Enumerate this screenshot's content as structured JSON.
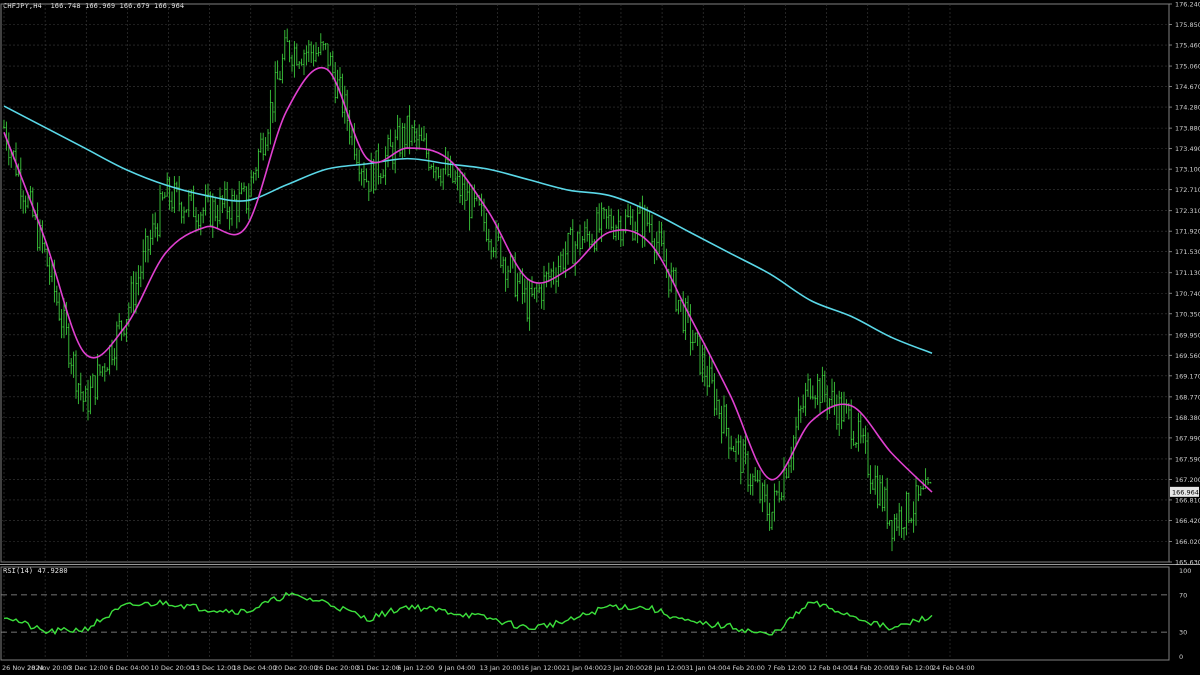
{
  "header": {
    "symbol": "CHFJPY,H4",
    "ohlc": "166.748 166.969 166.679 166.964"
  },
  "rsi_panel": {
    "label": "RSI(14) 47.9280",
    "levels": [
      "100",
      "70",
      "30",
      "0"
    ]
  },
  "price_axis": {
    "ticks": [
      "176.240",
      "175.850",
      "175.460",
      "175.060",
      "174.670",
      "174.280",
      "173.880",
      "173.490",
      "173.100",
      "172.710",
      "172.310",
      "171.920",
      "171.530",
      "171.130",
      "170.740",
      "170.350",
      "169.950",
      "169.560",
      "169.170",
      "168.770",
      "168.380",
      "167.990",
      "167.590",
      "167.200",
      "166.810",
      "166.420",
      "166.020",
      "165.630"
    ],
    "current_price": "166.964"
  },
  "time_axis": {
    "ticks": [
      "26 Nov 2024",
      "28 Nov 20:00",
      "3 Dec 12:00",
      "6 Dec 04:00",
      "10 Dec 20:00",
      "13 Dec 12:00",
      "18 Dec 04:00",
      "20 Dec 20:00",
      "26 Dec 20:00",
      "31 Dec 12:00",
      "6 Jan 12:00",
      "9 Jan 04:00",
      "13 Jan 20:00",
      "16 Jan 12:00",
      "21 Jan 04:00",
      "23 Jan 20:00",
      "28 Jan 12:00",
      "31 Jan 04:00",
      "4 Feb 20:00",
      "7 Feb 12:00",
      "12 Feb 04:00",
      "14 Feb 20:00",
      "19 Feb 12:00",
      "24 Feb 04:00"
    ]
  },
  "colors": {
    "background": "#000000",
    "grid": "#3c3c3c",
    "bars": "#3cc83c",
    "ma_fast": "#e040d0",
    "ma_slow": "#5ad8e8",
    "rsi_line": "#3ce03c",
    "price_tag_bg": "#e6e6e6"
  },
  "chart_data": [
    {
      "type": "line",
      "title": "CHFJPY,H4",
      "subtitle": "166.748 166.969 166.679 166.964",
      "ylim": [
        165.63,
        176.24
      ],
      "series": [
        {
          "style": "bars",
          "x": [
            "26 Nov 2024",
            "28 Nov 20:00",
            "3 Dec 12:00",
            "6 Dec 04:00",
            "10 Dec 20:00",
            "13 Dec 12:00",
            "18 Dec 04:00",
            "20 Dec 20:00",
            "26 Dec 20:00",
            "31 Dec 12:00",
            "6 Jan 12:00",
            "9 Jan 04:00",
            "13 Jan 20:00",
            "16 Jan 12:00",
            "21 Jan 04:00",
            "23 Jan 20:00",
            "28 Jan 12:00",
            "31 Jan 04:00",
            "4 Feb 20:00",
            "7 Feb 12:00",
            "12 Feb 04:00",
            "14 Feb 20:00",
            "19 Feb 12:00",
            "24 Feb 04:00"
          ],
          "values": [
            173.9,
            171.5,
            168.6,
            170.3,
            172.6,
            172.3,
            172.5,
            175.4,
            175.3,
            172.9,
            173.8,
            173.0,
            172.0,
            170.5,
            171.6,
            172.1,
            172.1,
            170.0,
            168.0,
            166.5,
            169.1,
            168.3,
            166.4,
            166.96
          ]
        },
        {
          "style": "ma_fast",
          "x": [
            "26 Nov 2024",
            "28 Nov 20:00",
            "3 Dec 12:00",
            "6 Dec 04:00",
            "10 Dec 20:00",
            "13 Dec 12:00",
            "18 Dec 04:00",
            "20 Dec 20:00",
            "26 Dec 20:00",
            "31 Dec 12:00",
            "6 Jan 12:00",
            "9 Jan 04:00",
            "13 Jan 20:00",
            "16 Jan 12:00",
            "21 Jan 04:00",
            "23 Jan 20:00",
            "28 Jan 12:00",
            "31 Jan 04:00",
            "4 Feb 20:00",
            "7 Feb 12:00",
            "12 Feb 04:00",
            "14 Feb 20:00",
            "19 Feb 12:00",
            "24 Feb 04:00"
          ],
          "values": [
            173.8,
            171.8,
            169.6,
            170.1,
            171.5,
            172.0,
            172.0,
            174.2,
            175.0,
            173.3,
            173.5,
            173.3,
            172.3,
            171.0,
            171.2,
            171.9,
            171.7,
            170.3,
            168.8,
            167.2,
            168.3,
            168.6,
            167.7,
            166.96
          ]
        },
        {
          "style": "ma_slow",
          "x": [
            "26 Nov 2024",
            "28 Nov 20:00",
            "3 Dec 12:00",
            "6 Dec 04:00",
            "10 Dec 20:00",
            "13 Dec 12:00",
            "18 Dec 04:00",
            "20 Dec 20:00",
            "26 Dec 20:00",
            "31 Dec 12:00",
            "6 Jan 12:00",
            "9 Jan 04:00",
            "13 Jan 20:00",
            "16 Jan 12:00",
            "21 Jan 04:00",
            "23 Jan 20:00",
            "28 Jan 12:00",
            "31 Jan 04:00",
            "4 Feb 20:00",
            "7 Feb 12:00",
            "12 Feb 04:00",
            "14 Feb 20:00",
            "19 Feb 12:00",
            "24 Feb 04:00"
          ],
          "values": [
            174.3,
            173.9,
            173.5,
            173.1,
            172.8,
            172.6,
            172.5,
            172.8,
            173.1,
            173.2,
            173.3,
            173.2,
            173.1,
            172.9,
            172.7,
            172.6,
            172.3,
            171.9,
            171.5,
            171.1,
            170.6,
            170.3,
            169.9,
            169.6
          ]
        }
      ]
    },
    {
      "type": "line",
      "title": "RSI(14) 47.9280",
      "ylim": [
        0,
        100
      ],
      "levels": [
        70,
        30
      ],
      "series": [
        {
          "x": [
            "26 Nov 2024",
            "28 Nov 20:00",
            "3 Dec 12:00",
            "6 Dec 04:00",
            "10 Dec 20:00",
            "13 Dec 12:00",
            "18 Dec 04:00",
            "20 Dec 20:00",
            "26 Dec 20:00",
            "31 Dec 12:00",
            "6 Jan 12:00",
            "9 Jan 04:00",
            "13 Jan 20:00",
            "16 Jan 12:00",
            "21 Jan 04:00",
            "23 Jan 20:00",
            "28 Jan 12:00",
            "31 Jan 04:00",
            "4 Feb 20:00",
            "7 Feb 12:00",
            "12 Feb 04:00",
            "14 Feb 20:00",
            "19 Feb 12:00",
            "24 Feb 04:00"
          ],
          "values": [
            48,
            30,
            33,
            58,
            62,
            55,
            52,
            70,
            62,
            44,
            58,
            52,
            45,
            34,
            42,
            58,
            56,
            40,
            36,
            26,
            62,
            48,
            33,
            47.93
          ]
        }
      ]
    }
  ]
}
